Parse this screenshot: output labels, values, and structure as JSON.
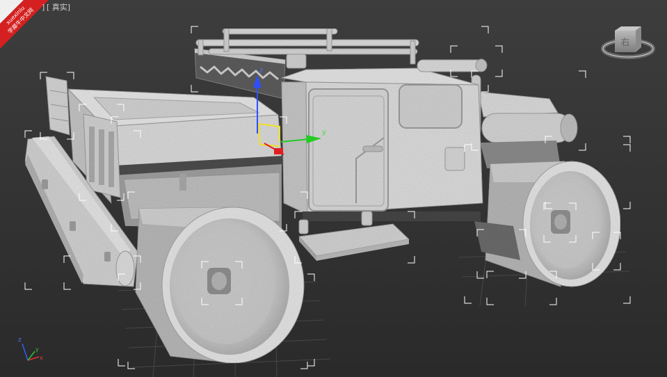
{
  "viewport": {
    "prefix": "]",
    "label": "[ 真实]",
    "background_top": "#3d3d3d",
    "background_bottom": "#2a2a2a"
  },
  "watermark": {
    "latin": "xuexiniu",
    "chinese": "学犀牛中文网",
    "color": "#d42020"
  },
  "viewcube": {
    "label": "右"
  },
  "gizmo": {
    "z": "z",
    "y": "y",
    "colors": {
      "x": "#e02020",
      "y": "#22cc22",
      "z": "#2f4fff",
      "plane": "#f0e020"
    }
  },
  "axis_tripod": {
    "z": "z",
    "x": "x",
    "y": "y"
  },
  "model": {
    "surface_color": "#dcdcdc",
    "selection_color": "#ffffff"
  },
  "icons": {
    "viewcube": "viewcube-icon",
    "gizmo": "move-gizmo-icon",
    "tripod": "axis-tripod-icon"
  }
}
